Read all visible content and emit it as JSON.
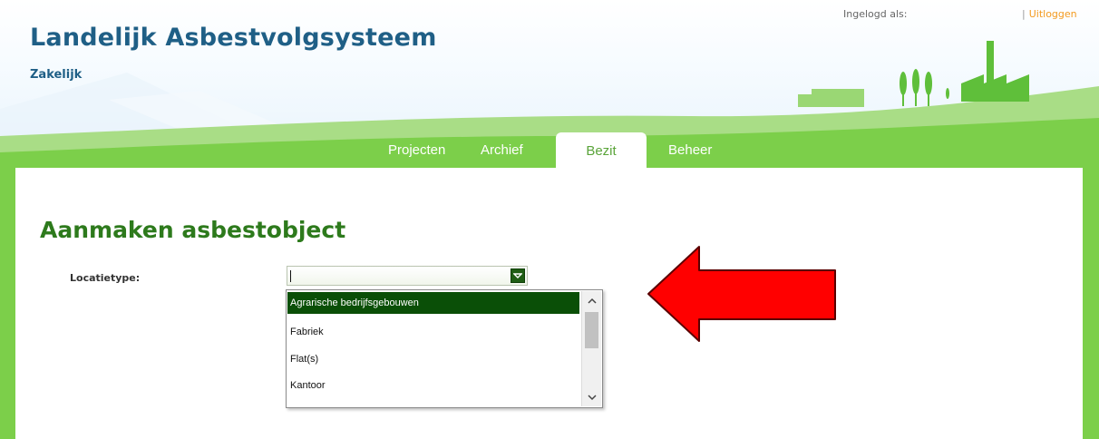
{
  "app": {
    "title": "Landelijk Asbestvolgsysteem",
    "subtitle": "Zakelijk"
  },
  "user_bar": {
    "logged_in_label": "Ingelogd als:",
    "separator": "|",
    "logout_label": "Uitloggen"
  },
  "tabs": [
    {
      "label": "Projecten",
      "active": false
    },
    {
      "label": "Archief",
      "active": false
    },
    {
      "label": "Bezit",
      "active": true
    },
    {
      "label": "Beheer",
      "active": false
    }
  ],
  "page": {
    "title": "Aanmaken asbestobject"
  },
  "form": {
    "location_type": {
      "label": "Locatietype:",
      "value": "",
      "options": [
        "Agrarische bedrijfsgebouwen",
        "Fabriek",
        "Flat(s)",
        "Kantoor"
      ],
      "highlighted_index": 0
    }
  },
  "colors": {
    "title_blue": "#1f5f86",
    "grass_green": "#7ccf4a",
    "heading_green": "#2d7a1c",
    "selected_option_bg": "#0a4f07",
    "logout_orange": "#f39a1e",
    "annotation_arrow": "#ff0000"
  },
  "icons": {
    "combo_button": "chevron-down-icon",
    "scroll_up": "chevron-up-icon",
    "scroll_down": "chevron-down-icon",
    "annotation": "left-arrow-icon"
  }
}
